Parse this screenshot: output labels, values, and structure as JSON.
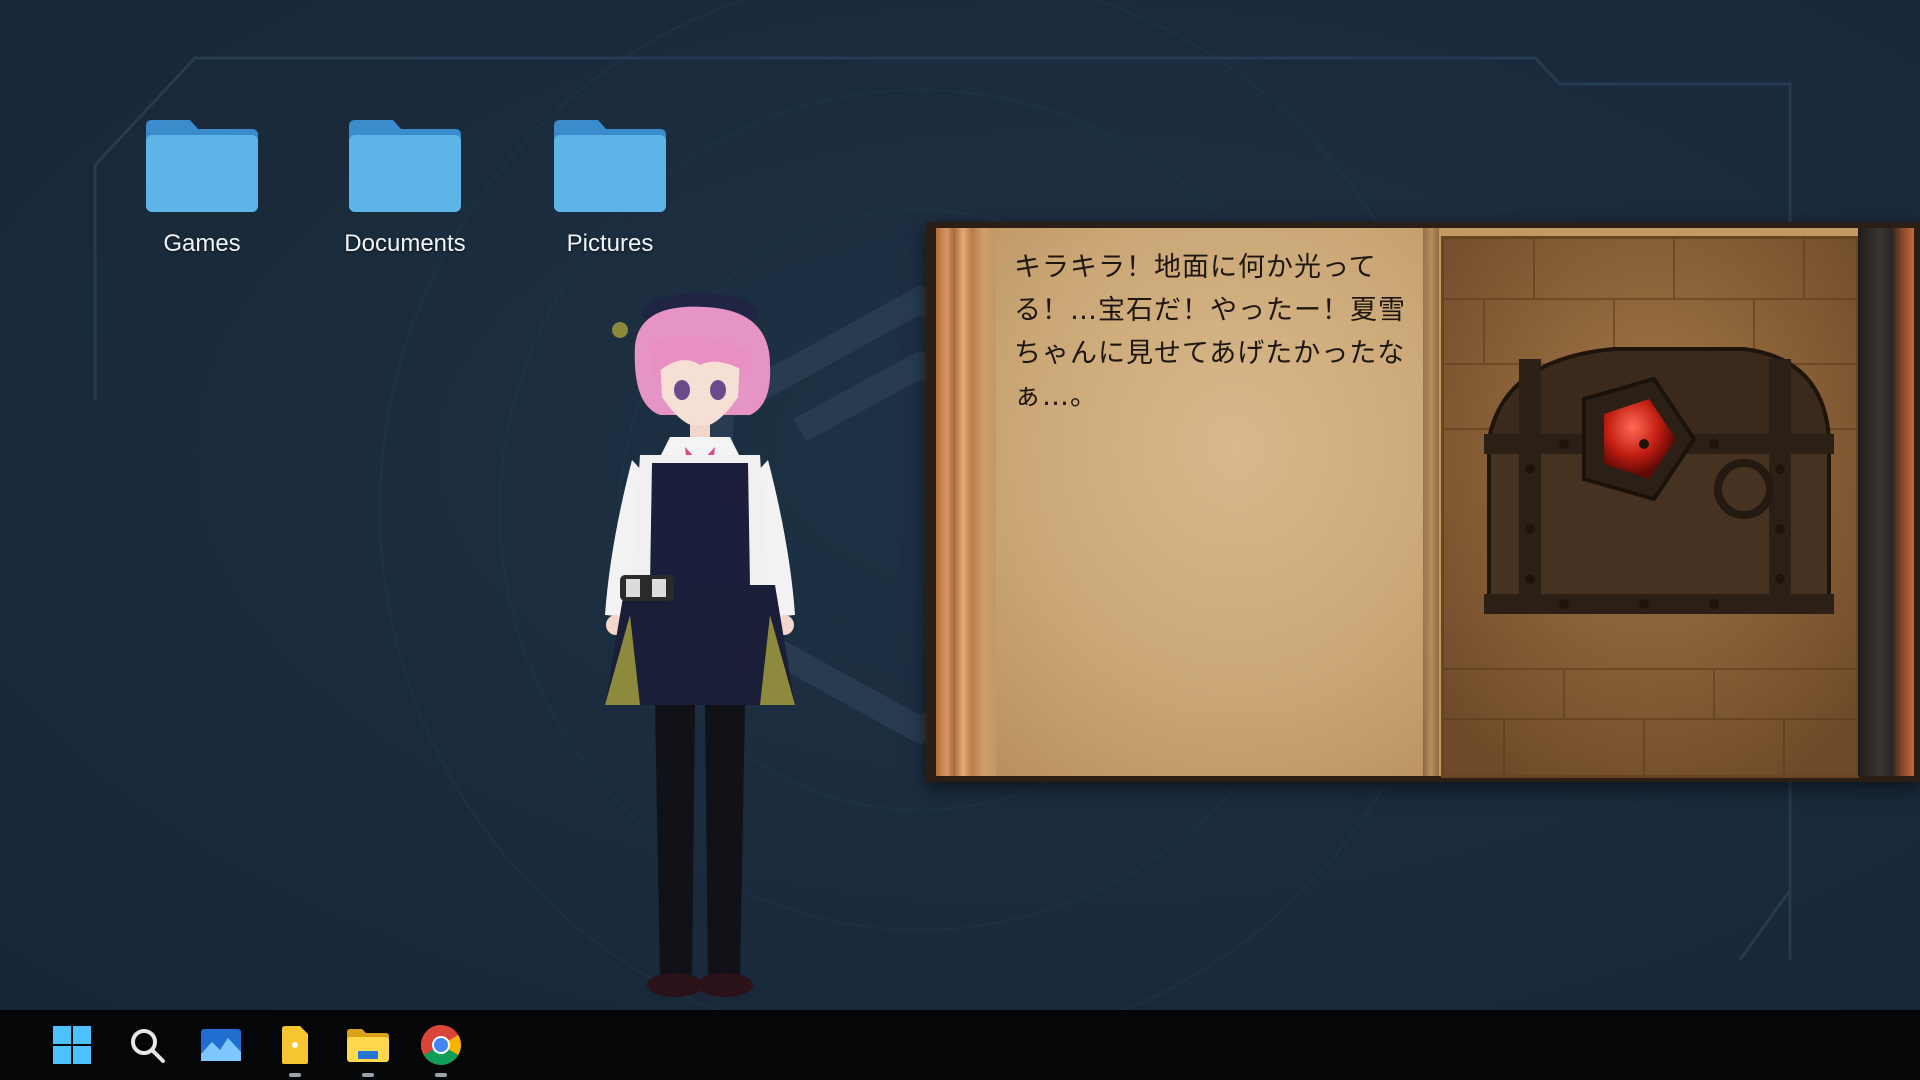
{
  "desktop": {
    "icons": [
      {
        "label": "Games"
      },
      {
        "label": "Documents"
      },
      {
        "label": "Pictures"
      }
    ]
  },
  "book": {
    "text": "キラキラ！地面に何か光ってる！…宝石だ！やったー！夏雪ちゃんに見せてあげたかったなぁ…。"
  },
  "taskbar": {
    "items": [
      "start-icon",
      "search-icon",
      "photos-icon",
      "notes-icon",
      "file-explorer-icon",
      "chrome-icon"
    ]
  },
  "colors": {
    "desktop_bg": "#1a2a3b",
    "folder": "#5db4e6",
    "taskbar": "#040608",
    "page": "#caa675"
  }
}
